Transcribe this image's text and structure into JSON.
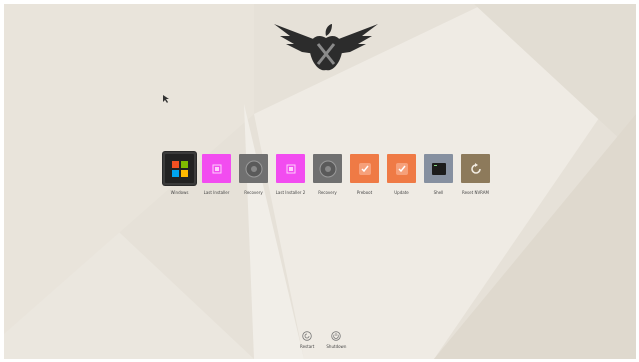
{
  "screen": {
    "colors": {
      "background": "#e6e1d8",
      "light_band": "#efebe4",
      "shade_band": "#d9d3c8",
      "selection_frame": "#3b3b3b"
    }
  },
  "logo": {
    "icon": "winged-apple-logo"
  },
  "top_right": {
    "line1": "",
    "line2": ""
  },
  "boot_entries": [
    {
      "label": "Windows",
      "icon": "windows-icon",
      "color": "#222222",
      "selected": true
    },
    {
      "label": "Last Installer",
      "icon": "installer-icon",
      "color": "#f24cf0",
      "selected": false
    },
    {
      "label": "Recovery",
      "icon": "recovery-disk-icon",
      "color": "#707070",
      "selected": false
    },
    {
      "label": "Last Installer 2",
      "icon": "installer-icon",
      "color": "#f24cf0",
      "selected": false
    },
    {
      "label": "Recovery",
      "icon": "recovery-disk-icon",
      "color": "#707070",
      "selected": false
    },
    {
      "label": "Preboot",
      "icon": "check-disk-icon",
      "color": "#ef7a45",
      "selected": false
    },
    {
      "label": "Update",
      "icon": "check-disk-icon",
      "color": "#ef7a45",
      "selected": false
    },
    {
      "label": "Shell",
      "icon": "terminal-icon",
      "color": "#8690a0",
      "selected": false
    },
    {
      "label": "Reset NVRAM",
      "icon": "reset-icon",
      "color": "#8d7a5b",
      "selected": false
    }
  ],
  "bottom_buttons": {
    "restart_label": "Restart",
    "shutdown_label": "Shutdown"
  }
}
